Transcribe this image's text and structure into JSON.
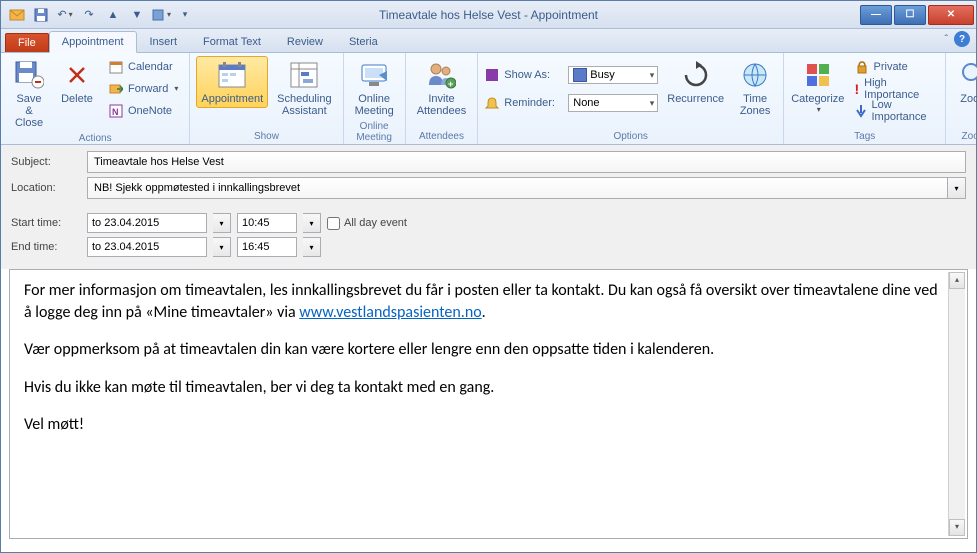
{
  "window": {
    "title_prefix": "Timeavtale hos Helse Vest",
    "title_suffix": " - Appointment"
  },
  "tabs": {
    "file": "File",
    "appointment": "Appointment",
    "insert": "Insert",
    "format_text": "Format Text",
    "review": "Review",
    "steria": "Steria"
  },
  "ribbon": {
    "actions": {
      "label": "Actions",
      "save_close": "Save &\nClose",
      "delete": "Delete",
      "calendar": "Calendar",
      "forward": "Forward",
      "onenote": "OneNote"
    },
    "show": {
      "label": "Show",
      "appointment": "Appointment",
      "scheduling": "Scheduling\nAssistant"
    },
    "online": {
      "label": "Online Meeting",
      "meeting": "Online\nMeeting"
    },
    "attendees": {
      "label": "Attendees",
      "invite": "Invite\nAttendees"
    },
    "options": {
      "label": "Options",
      "show_as": "Show As:",
      "show_as_value": "Busy",
      "reminder": "Reminder:",
      "reminder_value": "None",
      "recurrence": "Recurrence",
      "time_zones": "Time\nZones"
    },
    "tags": {
      "label": "Tags",
      "categorize": "Categorize",
      "private": "Private",
      "high": "High Importance",
      "low": "Low Importance"
    },
    "zoom": {
      "label": "Zoom",
      "zoom": "Zoom"
    }
  },
  "fields": {
    "subject_label": "Subject:",
    "subject_value": "Timeavtale hos Helse Vest",
    "location_label": "Location:",
    "location_value": "NB! Sjekk oppmøtested i innkallingsbrevet",
    "start_label": "Start time:",
    "start_date": "to 23.04.2015",
    "start_time": "10:45",
    "end_label": "End time:",
    "end_date": "to 23.04.2015",
    "end_time": "16:45",
    "all_day": "All day event"
  },
  "body": {
    "p1a": "For mer informasjon om timeavtalen, les innkallingsbrevet du får i posten eller ta kontakt. Du kan også få oversikt over timeavtalene dine ved å logge deg inn på «Mine timeavtaler» via ",
    "link": "www.vestlandspasienten.no",
    "p1b": ".",
    "p2": "Vær oppmerksom på at timeavtalen din kan være kortere eller lengre enn den oppsatte tiden i kalenderen.",
    "p3": "Hvis du ikke kan møte til timeavtalen, ber vi deg ta kontakt med en gang.",
    "p4": "Vel møtt!"
  }
}
